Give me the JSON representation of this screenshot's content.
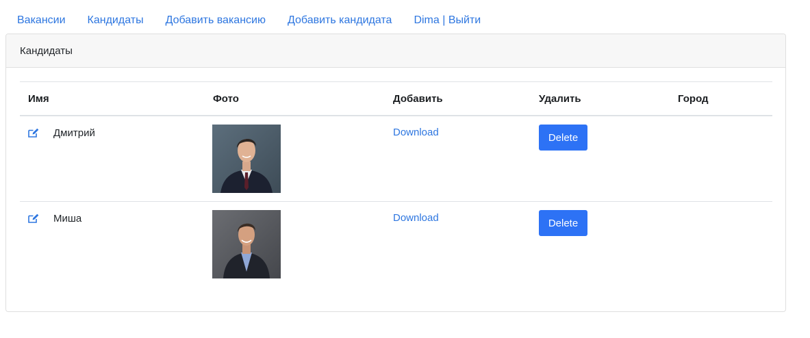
{
  "nav": {
    "items": [
      {
        "label": "Вакансии"
      },
      {
        "label": "Кандидаты"
      },
      {
        "label": "Добавить вакансию"
      },
      {
        "label": "Добавить кандидата"
      },
      {
        "label": "Dima | Выйти"
      }
    ]
  },
  "card": {
    "title": "Кандидаты"
  },
  "table": {
    "headers": [
      "Имя",
      "Фото",
      "Добавить",
      "Удалить",
      "Город"
    ],
    "rows": [
      {
        "name": "Дмитрий",
        "download_label": "Download",
        "delete_label": "Delete",
        "city": ""
      },
      {
        "name": "Миша",
        "download_label": "Download",
        "delete_label": "Delete",
        "city": ""
      }
    ]
  },
  "colors": {
    "link": "#2d76e0",
    "button": "#2d72f5",
    "header_bg": "#f7f7f7"
  },
  "icons": {
    "edit": "edit-icon",
    "photo": "person-photo"
  }
}
